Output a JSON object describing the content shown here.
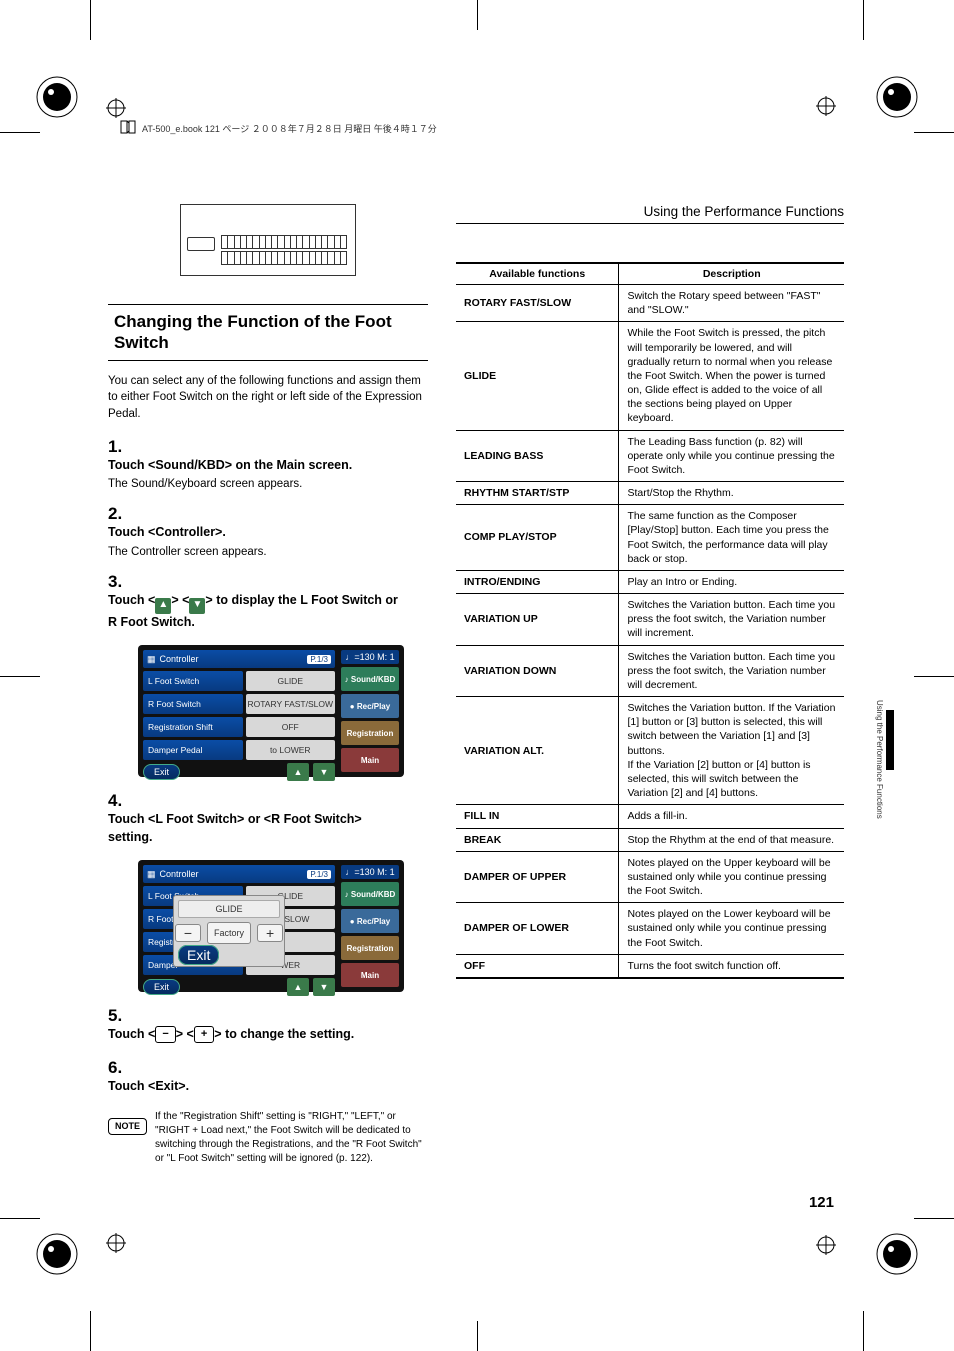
{
  "header_line": "AT-500_e.book 121 ページ ２００８年７月２８日 月曜日 午後４時１７分",
  "breadcrumb": "Using the Performance Functions",
  "section_heading": "Changing the Function of the Foot Switch",
  "intro": "You can select any of the following functions and assign them to either Foot Switch on the right or left side of the Expression Pedal.",
  "steps": {
    "s1": {
      "num": "1.",
      "title": "Touch <Sound/KBD> on the Main screen.",
      "sub": "The Sound/Keyboard screen appears."
    },
    "s2": {
      "num": "2.",
      "title": "Touch <Controller>.",
      "sub": "The Controller screen appears."
    },
    "s3": {
      "num": "3.",
      "title_pre": "Touch <",
      "title_mid": "> <",
      "title_post": "> to display the L Foot Switch or R Foot Switch."
    },
    "s4": {
      "num": "4.",
      "title": "Touch <L Foot Switch> or <R Foot Switch> setting."
    },
    "s5": {
      "num": "5.",
      "title_pre": "Touch <",
      "minus": "−",
      "title_mid": "> <",
      "plus": "+",
      "title_post": "> to change the setting."
    },
    "s6": {
      "num": "6.",
      "title": "Touch <Exit>."
    }
  },
  "screen1": {
    "title": "Controller",
    "page": "P.1/3",
    "tempo": "♩=130 M: 1",
    "rows": {
      "r1": {
        "l": "L Foot Switch",
        "r": "GLIDE"
      },
      "r2": {
        "l": "R Foot Switch",
        "r": "ROTARY FAST/SLOW"
      },
      "r3": {
        "l": "Registration Shift",
        "r": "OFF"
      },
      "r4": {
        "l": "Damper Pedal",
        "r": "to LOWER"
      }
    },
    "exit": "Exit",
    "side": {
      "sound": "♪ Sound/KBD",
      "rec": "● Rec/Play",
      "reg": "Registration",
      "main": "Main"
    }
  },
  "screen2": {
    "title": "Controller",
    "page": "P.1/3",
    "tempo": "♩=130 M: 1",
    "rows": {
      "r1": {
        "l": "L Foot Switch",
        "r": "GLIDE"
      },
      "r2": {
        "l": "R Foot",
        "r": "ST/SLOW"
      },
      "r3": {
        "l": "Registr",
        "r": ""
      },
      "r4": {
        "l": "Damper",
        "r": "WER"
      }
    },
    "overlay": {
      "value": "GLIDE",
      "factory": "Factory",
      "exit": "Exit"
    },
    "exit": "Exit",
    "side": {
      "sound": "♪ Sound/KBD",
      "rec": "● Rec/Play",
      "reg": "Registration",
      "main": "Main"
    }
  },
  "note": {
    "badge": "NOTE",
    "text": "If the \"Registration Shift\" setting is \"RIGHT,\" \"LEFT,\" or \"RIGHT + Load next,\" the Foot Switch will be dedicated to switching through the Registrations, and the \"R Foot Switch\" or \"L Foot Switch\" setting will be ignored (p. 122)."
  },
  "table": {
    "head": {
      "c1": "Available functions",
      "c2": "Description"
    },
    "rows": [
      {
        "name": "ROTARY FAST/SLOW",
        "desc": "Switch the Rotary speed between \"FAST\" and \"SLOW.\""
      },
      {
        "name": "GLIDE",
        "desc": "While the Foot Switch is pressed, the pitch will temporarily be lowered, and will gradually return to normal when you release the Foot Switch. When the power is turned on, Glide effect is added to the voice of all the sections being played on Upper keyboard."
      },
      {
        "name": "LEADING BASS",
        "desc": "The Leading Bass function (p. 82) will operate only while you continue pressing the Foot Switch."
      },
      {
        "name": "RHYTHM START/STP",
        "desc": "Start/Stop the Rhythm."
      },
      {
        "name": "COMP PLAY/STOP",
        "desc": "The same function as the Composer [Play/Stop] button. Each time you press the Foot Switch, the performance data will play back or stop."
      },
      {
        "name": "INTRO/ENDING",
        "desc": "Play an Intro or Ending."
      },
      {
        "name": "VARIATION UP",
        "desc": "Switches the Variation button. Each time you press the foot switch, the Variation number will increment."
      },
      {
        "name": "VARIATION DOWN",
        "desc": "Switches the Variation button. Each time you press the foot switch, the Variation number will decrement."
      },
      {
        "name": "VARIATION ALT.",
        "desc": "Switches the Variation button. If the Variation [1] button or [3] button is selected, this will switch between the Variation [1] and [3] buttons.\nIf the Variation [2] button or [4] button is selected, this will switch between the Variation [2] and [4] buttons."
      },
      {
        "name": "FILL IN",
        "desc": "Adds a fill-in."
      },
      {
        "name": "BREAK",
        "desc": "Stop the Rhythm at the end of that measure."
      },
      {
        "name": "DAMPER OF UPPER",
        "desc": "Notes played on the Upper keyboard will be sustained only while you continue pressing the Foot Switch."
      },
      {
        "name": "DAMPER OF LOWER",
        "desc": "Notes played on the Lower keyboard will be sustained only while you continue pressing the Foot Switch."
      },
      {
        "name": "OFF",
        "desc": "Turns the foot switch function off."
      }
    ]
  },
  "side_tab_label": "Using the Performance Functions",
  "page_num": "121"
}
